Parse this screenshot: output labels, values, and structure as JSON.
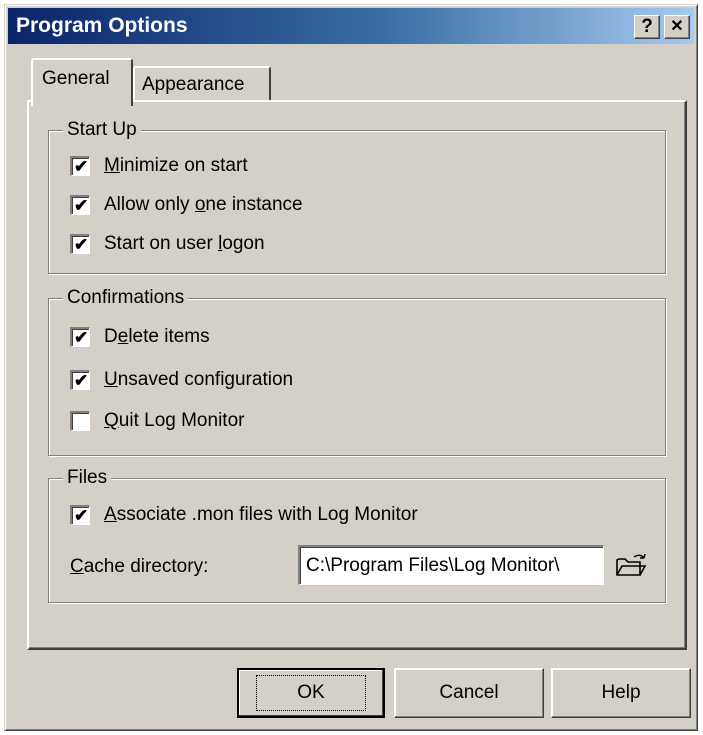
{
  "window": {
    "title": "Program Options",
    "help_button": "?",
    "close_button": "✕"
  },
  "tabs": [
    {
      "label": "General",
      "active": true
    },
    {
      "label": "Appearance",
      "active": false
    }
  ],
  "groups": {
    "startup": {
      "title": "Start Up",
      "items": [
        {
          "pre": "",
          "accel": "M",
          "post": "inimize on start",
          "checked": true
        },
        {
          "pre": "Allow only ",
          "accel": "o",
          "post": "ne instance",
          "checked": true
        },
        {
          "pre": "Start on user ",
          "accel": "l",
          "post": "ogon",
          "checked": true
        }
      ]
    },
    "confirmations": {
      "title": "Confirmations",
      "items": [
        {
          "pre": "D",
          "accel": "e",
          "post": "lete items",
          "checked": true
        },
        {
          "pre": "",
          "accel": "U",
          "post": "nsaved configuration",
          "checked": true
        },
        {
          "pre": "",
          "accel": "Q",
          "post": "uit Log Monitor",
          "checked": false
        }
      ]
    },
    "files": {
      "title": "Files",
      "associate": {
        "pre": "",
        "accel": "A",
        "post": "ssociate .mon files with Log Monitor",
        "checked": true
      },
      "cache_label_accel": "C",
      "cache_label_rest": "ache directory:",
      "cache_value": "C:\\Program Files\\Log Monitor\\",
      "browse_icon": "folder-open-icon"
    }
  },
  "buttons": {
    "ok": "OK",
    "cancel": "Cancel",
    "help": "Help"
  },
  "check_glyph": "✔"
}
